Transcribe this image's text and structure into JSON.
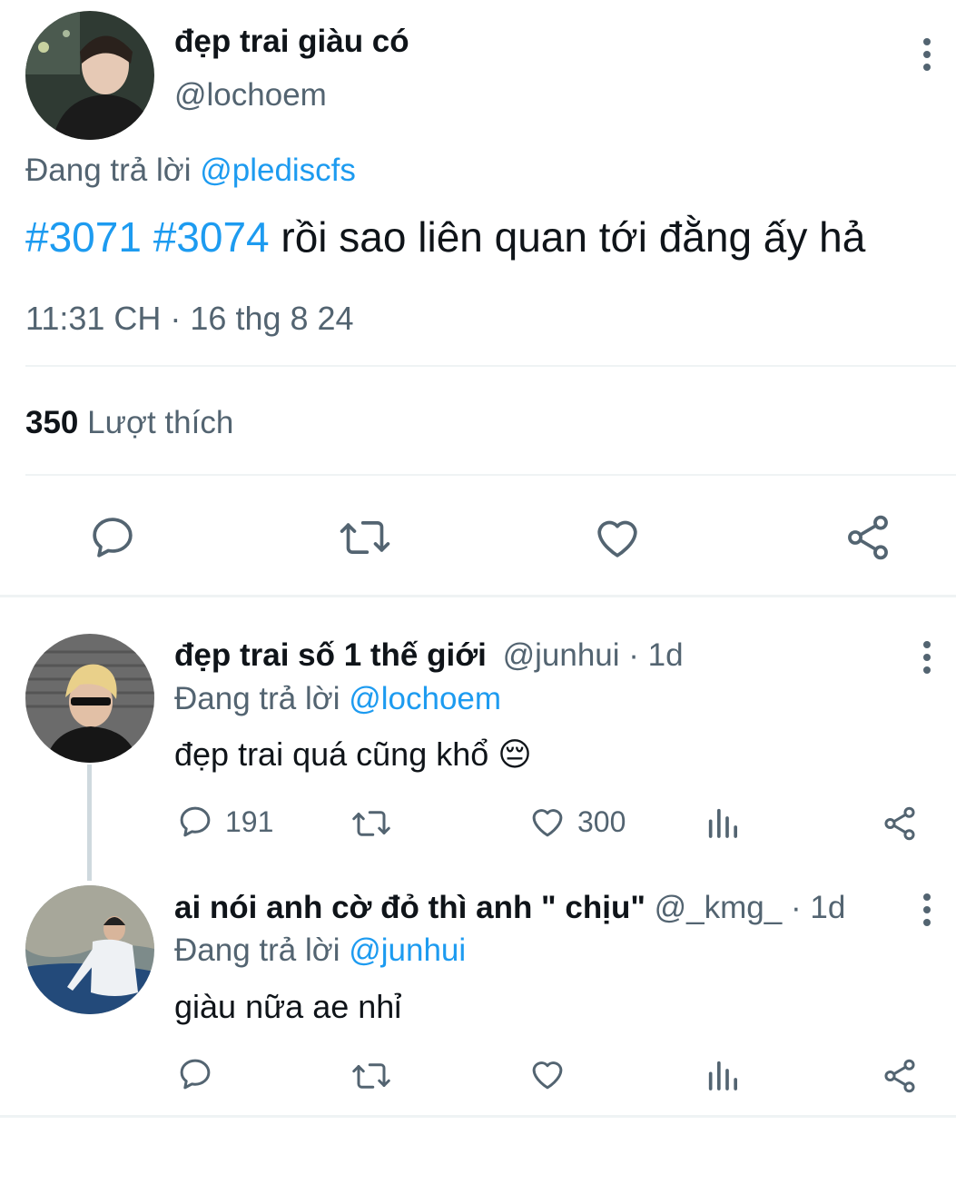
{
  "main_tweet": {
    "author_name": "đẹp trai giàu có",
    "author_handle": "@lochoem",
    "replying_prefix": "Đang trả lời",
    "replying_to": "@plediscfs",
    "hashtag1": "#3071",
    "hashtag2": "#3074",
    "text": "rồi sao liên quan tới đằng ấy hả",
    "timestamp": "11:31 CH · 16 thg 8 24",
    "likes_count": "350",
    "likes_label": "Lượt thích"
  },
  "replies": [
    {
      "author_name": "đẹp trai số 1 thế giới",
      "author_handle": "@junhui",
      "time": "· 1d",
      "replying_prefix": "Đang trả lời",
      "replying_to": "@lochoem",
      "text": "đẹp trai quá cũng khổ 😔",
      "reply_count": "191",
      "like_count": "300"
    },
    {
      "author_name": "ai nói anh cờ đỏ thì anh \" chịu\"",
      "author_handle": "@_kmg_",
      "time": "· 1d",
      "replying_prefix": "Đang trả lời",
      "replying_to": "@junhui",
      "text": "giàu nữa ae nhỉ",
      "reply_count": "",
      "like_count": ""
    }
  ],
  "colors": {
    "accent": "#1d9bf0",
    "secondary_text": "#536471",
    "primary_text": "#0f1419",
    "divider": "#eff3f4"
  }
}
